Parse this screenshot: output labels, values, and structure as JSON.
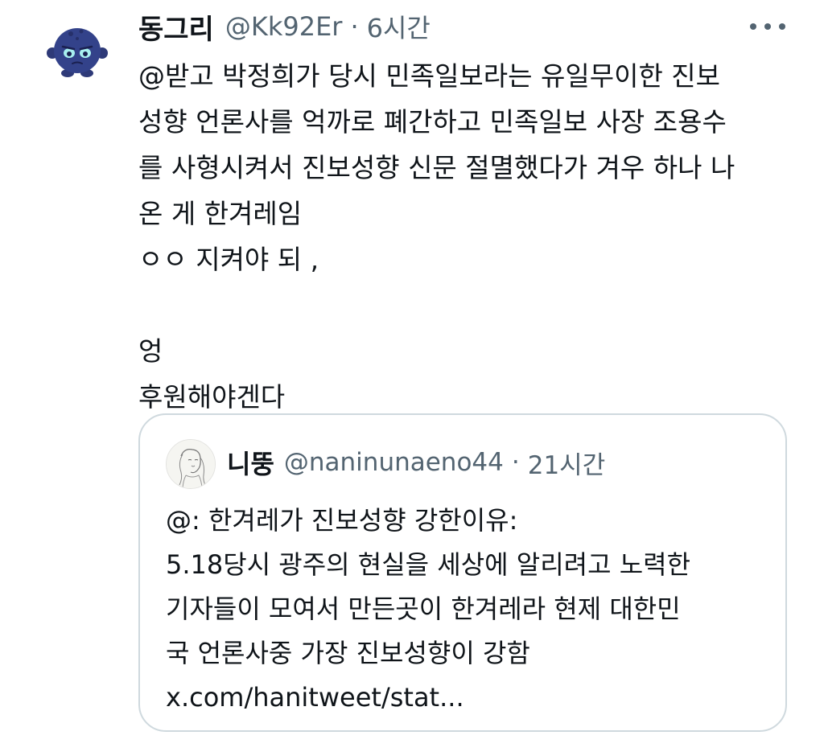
{
  "tweet": {
    "author": {
      "display_name": "동그리",
      "handle": "@Kk92Er",
      "separator": "·",
      "time": "6시간",
      "avatar_icon": "blue-round-creature-avatar-icon"
    },
    "more_icon": "more-horizontal-icon",
    "body_lines": [
      "@받고 박정희가 당시 민족일보라는 유일무이한 진보",
      "성향 언론사를 억까로 폐간하고 민족일보 사장 조용수",
      "를 사형시켜서 진보성향 신문 절멸했다가 겨우 하나 나",
      "온 게 한겨레임",
      "ㅇㅇ  지켜야 되 ,",
      "",
      "엉",
      "후원해야겐다"
    ]
  },
  "quote": {
    "author": {
      "display_name": "니뚱",
      "handle": "@naninunaeno44",
      "separator": "·",
      "time": "21시간",
      "avatar_icon": "sketch-portrait-avatar-icon"
    },
    "body_lines": [
      "@: 한겨레가 진보성향 강한이유:",
      "5.18당시 광주의 현실을 세상에 알리려고 노력한",
      "기자들이 모여서 만든곳이 한겨레라 현제 대한민",
      "국 언론사중 가장 진보성향이 강함",
      "x.com/hanitweet/stat..."
    ]
  },
  "colors": {
    "text_primary": "#0f1419",
    "text_secondary": "#536471",
    "border": "#cfd9de",
    "avatar_blue": "#2e3a78"
  }
}
